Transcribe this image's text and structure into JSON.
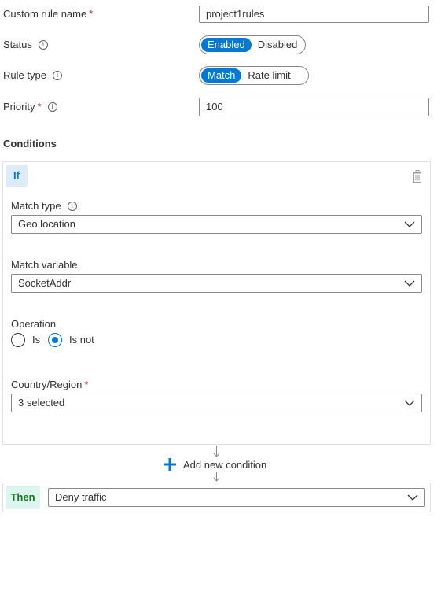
{
  "form": {
    "custom_rule_name": {
      "label": "Custom rule name",
      "required": "*",
      "value": "project1rules"
    },
    "status": {
      "label": "Status",
      "options": [
        "Enabled",
        "Disabled"
      ],
      "selected": "Enabled"
    },
    "rule_type": {
      "label": "Rule type",
      "options": [
        "Match",
        "Rate limit"
      ],
      "selected": "Match"
    },
    "priority": {
      "label": "Priority",
      "required": "*",
      "value": "100"
    }
  },
  "conditions": {
    "title": "Conditions",
    "if_label": "If",
    "match_type": {
      "label": "Match type",
      "value": "Geo location"
    },
    "match_variable": {
      "label": "Match variable",
      "value": "SocketAddr"
    },
    "operation": {
      "label": "Operation",
      "options": [
        "Is",
        "Is not"
      ],
      "selected": "Is not"
    },
    "country_region": {
      "label": "Country/Region",
      "required": "*",
      "value": "3 selected"
    },
    "add_condition_label": "Add new condition"
  },
  "then": {
    "label": "Then",
    "action_value": "Deny traffic"
  },
  "colors": {
    "accent": "#0078d4",
    "required": "#a4262c",
    "if_bg": "#deecf9",
    "then_bg": "#ddf5ef",
    "then_text": "#107c10"
  }
}
